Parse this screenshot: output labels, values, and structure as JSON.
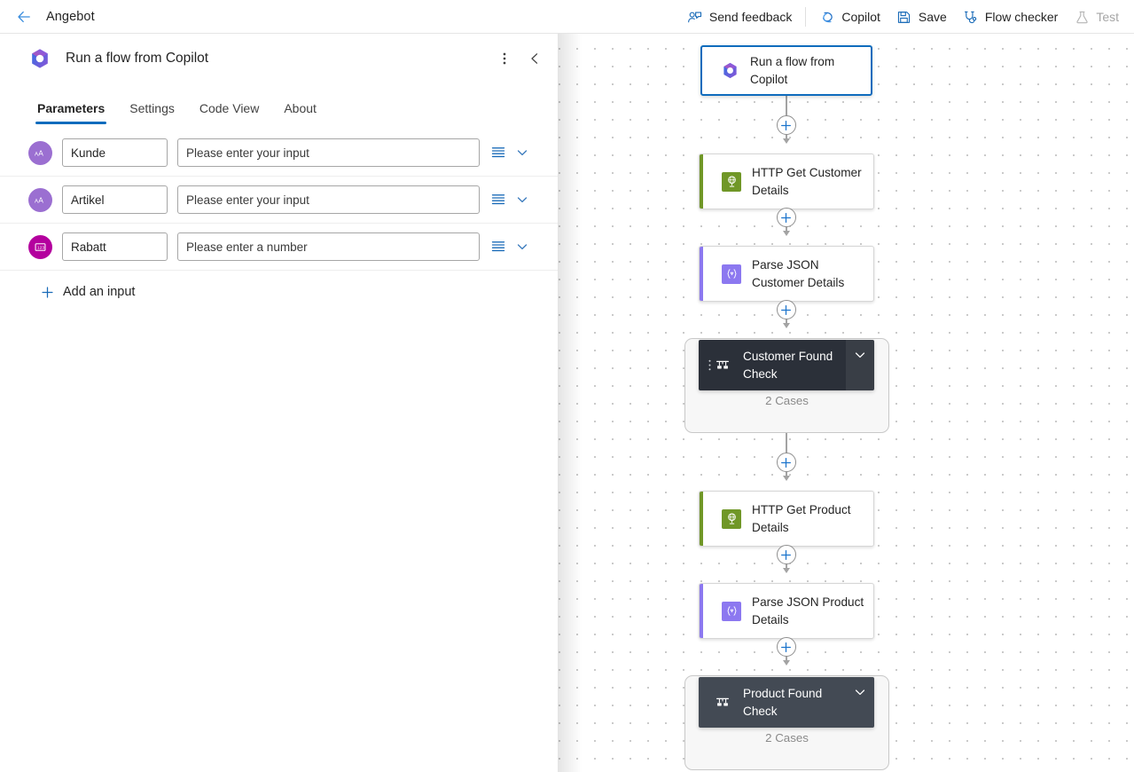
{
  "topbar": {
    "back_icon": "arrow-left-icon",
    "app_title": "Angebot",
    "actions": [
      {
        "label": "Send feedback",
        "icon": "person-feedback-icon",
        "disabled": false
      },
      {
        "label": "Copilot",
        "icon": "copilot-icon",
        "disabled": false
      },
      {
        "label": "Save",
        "icon": "save-disk-icon",
        "disabled": false
      },
      {
        "label": "Flow checker",
        "icon": "stethoscope-icon",
        "disabled": false
      },
      {
        "label": "Test",
        "icon": "flask-icon",
        "disabled": true
      }
    ]
  },
  "panel": {
    "logo_icon": "copilot-logo-icon",
    "title": "Run a flow from Copilot",
    "more_icon": "more-vertical-icon",
    "collapse_icon": "chevron-left-icon",
    "tabs": [
      {
        "label": "Parameters",
        "active": true
      },
      {
        "label": "Settings",
        "active": false
      },
      {
        "label": "Code View",
        "active": false
      },
      {
        "label": "About",
        "active": false
      }
    ],
    "parameters": [
      {
        "avatar_icon": "text-type-icon",
        "avatar_color": "#9B6FD1",
        "name": "Kunde",
        "placeholder": "Please enter your input",
        "value": "",
        "list_icon": "list-lines-icon",
        "chevron_icon": "chevron-down-icon"
      },
      {
        "avatar_icon": "text-type-icon",
        "avatar_color": "#9B6FD1",
        "name": "Artikel",
        "placeholder": "Please enter your input",
        "value": "",
        "list_icon": "list-lines-icon",
        "chevron_icon": "chevron-down-icon"
      },
      {
        "avatar_icon": "number-type-icon",
        "avatar_color": "#B4009E",
        "name": "Rabatt",
        "placeholder": "Please enter a number",
        "value": "",
        "list_icon": "list-lines-icon",
        "chevron_icon": "chevron-down-icon"
      }
    ],
    "add_input": {
      "icon": "plus-icon",
      "label": "Add an input"
    }
  },
  "canvas": {
    "nodes": [
      {
        "id": "trigger",
        "kind": "trigger",
        "label": "Run a flow from Copilot",
        "icon": "copilot-logo-icon",
        "accent": "",
        "selected": true
      },
      {
        "id": "http-get-customer",
        "kind": "action",
        "label": "HTTP Get Customer Details",
        "icon": "http-globe-icon",
        "accent": "#709727",
        "selected": false
      },
      {
        "id": "parse-json-customer",
        "kind": "action",
        "label": "Parse JSON Customer Details",
        "icon": "parse-json-icon",
        "accent": "#8C78F0",
        "selected": false
      },
      {
        "id": "http-get-product",
        "kind": "action",
        "label": "HTTP Get Product Details",
        "icon": "http-globe-icon",
        "accent": "#709727",
        "selected": false
      },
      {
        "id": "parse-json-product",
        "kind": "action",
        "label": "Parse JSON Product Details",
        "icon": "parse-json-icon",
        "accent": "#8C78F0",
        "selected": false
      }
    ],
    "scopes": [
      {
        "id": "customer-found-check",
        "label": "Customer Found Check",
        "icon": "switch-icon",
        "cases_text": "2 Cases",
        "header_color": "#2B3039",
        "collapse_icon": "chevron-down-icon",
        "drag_icon": "drag-dots-icon",
        "hovered": true
      },
      {
        "id": "product-found-check",
        "label": "Product Found Check",
        "icon": "switch-icon",
        "cases_text": "2 Cases",
        "header_color": "#434A54",
        "collapse_icon": "chevron-down-icon",
        "drag_icon": "",
        "hovered": false
      }
    ],
    "add_step_icon": "plus-circle-icon",
    "add_step_count": 5
  },
  "colors": {
    "accent_blue": "#0f6cbd",
    "http_green": "#709727",
    "parse_purple": "#8C78F0",
    "text_param_purple": "#9B6FD1",
    "number_param_magenta": "#B4009E",
    "scope_dark": "#2B3039",
    "scope_dark_alt": "#434A54"
  }
}
